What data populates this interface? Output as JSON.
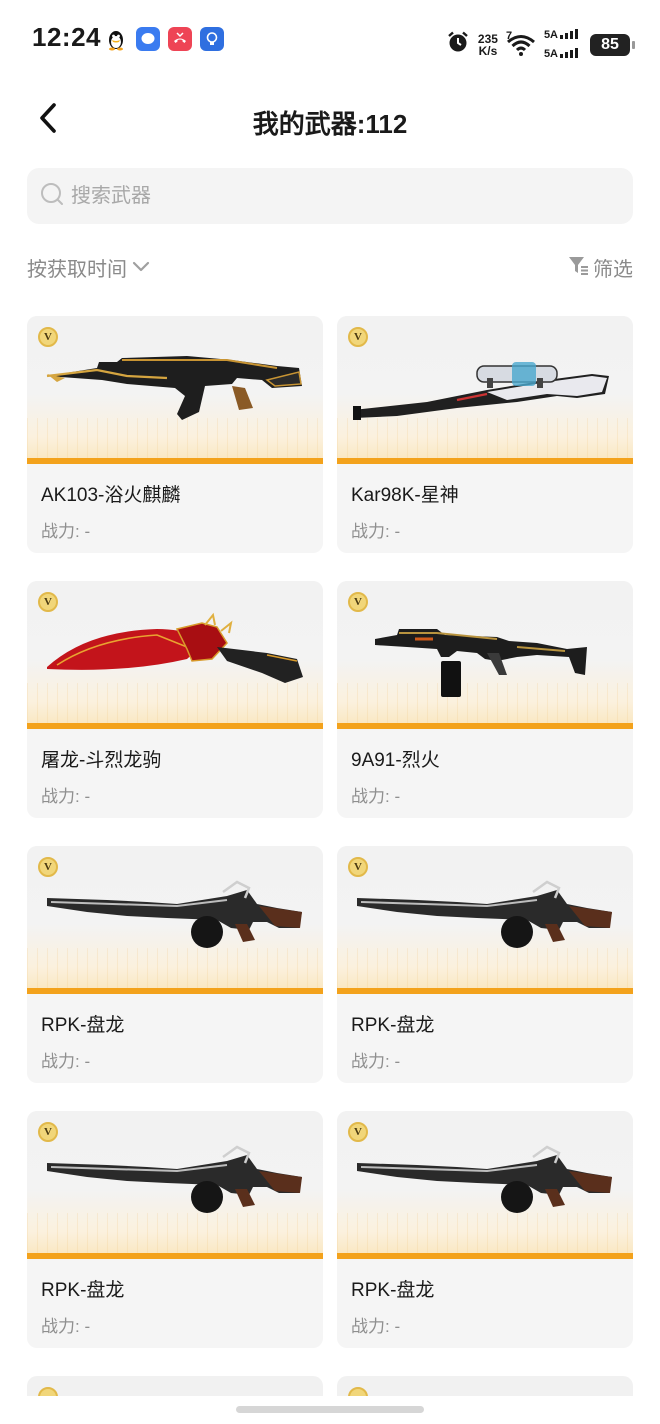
{
  "status_bar": {
    "time": "12:24",
    "net_speed_value": "235",
    "net_speed_unit": "K/s",
    "wifi_label": "7",
    "sim1_label": "5A",
    "sim2_label": "5A",
    "battery": "85"
  },
  "header": {
    "title": "我的武器:112"
  },
  "search": {
    "placeholder": "搜索武器"
  },
  "sort": {
    "label": "按获取时间"
  },
  "filter": {
    "label": "筛选"
  },
  "weapons": [
    {
      "name": "AK103-浴火麒麟",
      "power": "战力: -",
      "badge": "V"
    },
    {
      "name": "Kar98K-星神",
      "power": "战力: -",
      "badge": "V"
    },
    {
      "name": "屠龙-斗烈龙驹",
      "power": "战力: -",
      "badge": "V"
    },
    {
      "name": "9A91-烈火",
      "power": "战力: -",
      "badge": "V"
    },
    {
      "name": "RPK-盘龙",
      "power": "战力: -",
      "badge": "V"
    },
    {
      "name": "RPK-盘龙",
      "power": "战力: -",
      "badge": "V"
    },
    {
      "name": "RPK-盘龙",
      "power": "战力: -",
      "badge": "V"
    },
    {
      "name": "RPK-盘龙",
      "power": "战力: -",
      "badge": "V"
    }
  ],
  "colors": {
    "accent_orange": "#f3a21c",
    "badge_gold": "#f1d67a",
    "card_bg": "#f5f5f5",
    "muted_text": "#8f8f8f"
  }
}
